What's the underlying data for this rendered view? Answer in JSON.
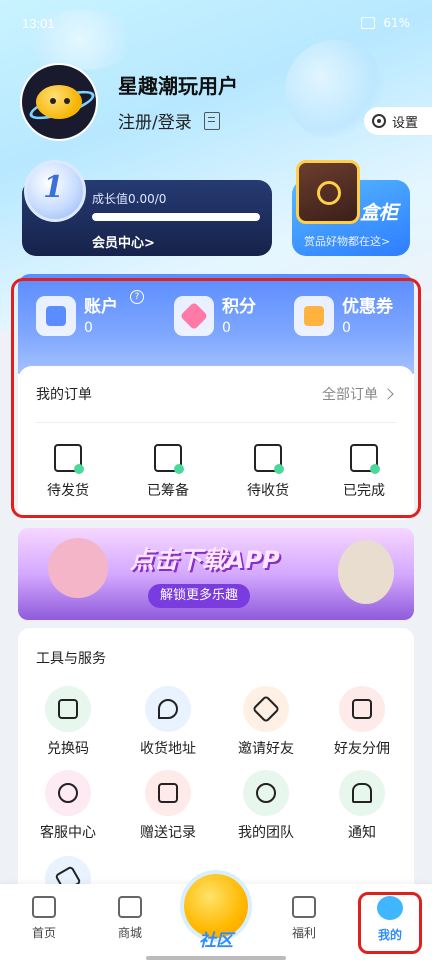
{
  "status_bar": {
    "time": "13:01",
    "battery": "61%"
  },
  "profile": {
    "username": "星趣潮玩用户",
    "login_label": "注册/登录",
    "settings_label": "设置"
  },
  "member": {
    "level": "1",
    "growth_label": "成长值0.00/0",
    "growth_progress": 0,
    "link_label": "会员中心>"
  },
  "cabinet": {
    "title": "盒柜",
    "subtitle": "赏品好物都在这>"
  },
  "assets": [
    {
      "label": "账户",
      "value": "0",
      "help": "?"
    },
    {
      "label": "积分",
      "value": "0"
    },
    {
      "label": "优惠券",
      "value": "0"
    }
  ],
  "orders": {
    "title": "我的订单",
    "all_label": "全部订单",
    "items": [
      {
        "label": "待发货",
        "icon": "truck-icon"
      },
      {
        "label": "已筹备",
        "icon": "bag-icon"
      },
      {
        "label": "待收货",
        "icon": "box-icon"
      },
      {
        "label": "已完成",
        "icon": "completed-icon"
      }
    ]
  },
  "banner": {
    "title": "点击下载APP",
    "subtitle": "解锁更多乐趣"
  },
  "tools": {
    "title": "工具与服务",
    "items": [
      {
        "label": "兑换码",
        "icon": "redeem-code-icon",
        "bg": "#e7f7ee"
      },
      {
        "label": "收货地址",
        "icon": "location-icon",
        "bg": "#e9f2ff"
      },
      {
        "label": "邀请好友",
        "icon": "handshake-icon",
        "bg": "#fff0e6"
      },
      {
        "label": "好友分佣",
        "icon": "wallet-icon",
        "bg": "#ffeaea"
      },
      {
        "label": "客服中心",
        "icon": "headset-icon",
        "bg": "#fdeaf3"
      },
      {
        "label": "赠送记录",
        "icon": "gift-heart-icon",
        "bg": "#ffeaea"
      },
      {
        "label": "我的团队",
        "icon": "team-icon",
        "bg": "#e7f7ee"
      },
      {
        "label": "通知",
        "icon": "bell-icon",
        "bg": "#e7f7ee"
      },
      {
        "label": "",
        "icon": "send-icon",
        "bg": "#e9f2ff"
      }
    ]
  },
  "tabbar": {
    "home": "首页",
    "shop": "商城",
    "community": "社区",
    "welfare": "福利",
    "me": "我的"
  }
}
